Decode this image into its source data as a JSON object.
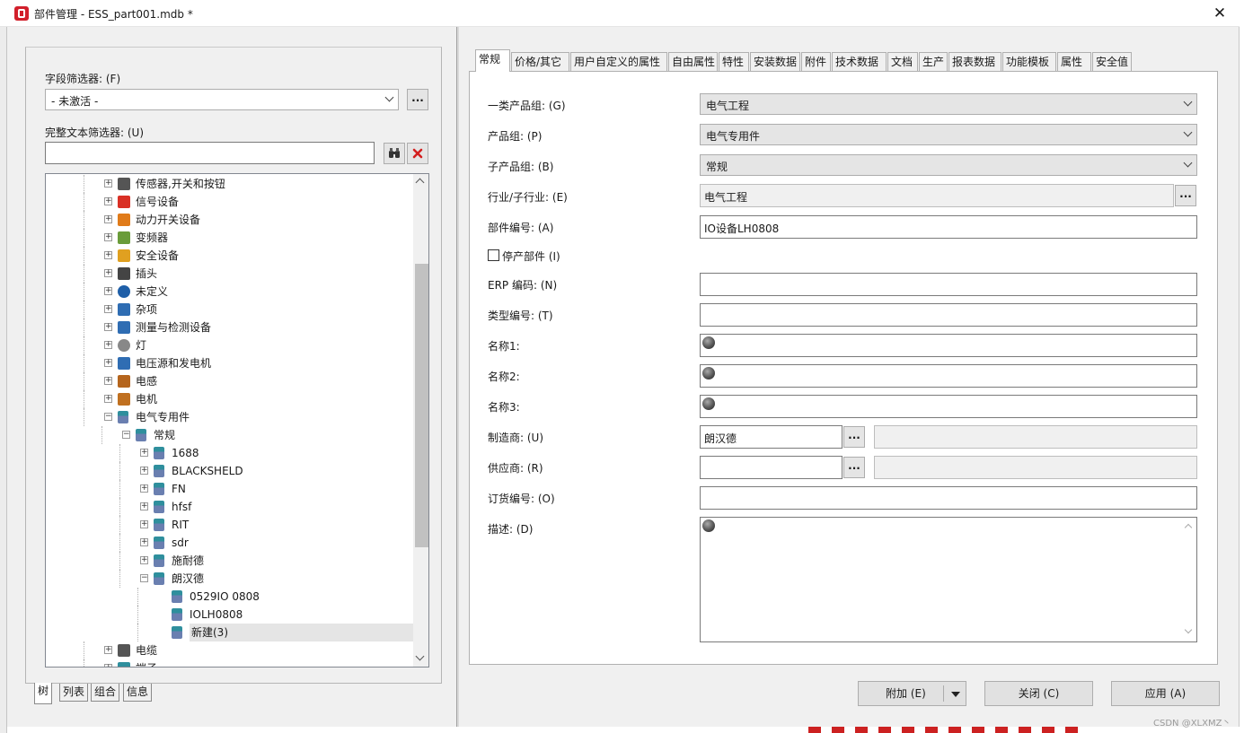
{
  "window": {
    "title": "部件管理 - ESS_part001.mdb *",
    "close": "✕"
  },
  "left": {
    "field_filter_label": "字段筛选器: (F)",
    "field_filter_value": "- 未激活 -",
    "more": "...",
    "text_filter_label": "完整文本筛选器: (U)",
    "text_filter_value": "",
    "tree": [
      {
        "label": "传感器,开关和按钮",
        "level": 0,
        "expander": "+",
        "icon": "sensor-icon",
        "color": "#555555"
      },
      {
        "label": "信号设备",
        "level": 0,
        "expander": "+",
        "icon": "signal-device-icon",
        "color": "#d93025"
      },
      {
        "label": "动力开关设备",
        "level": 0,
        "expander": "+",
        "icon": "power-switch-icon",
        "color": "#e07b1a"
      },
      {
        "label": "变频器",
        "level": 0,
        "expander": "+",
        "icon": "inverter-icon",
        "color": "#6a9c3a"
      },
      {
        "label": "安全设备",
        "level": 0,
        "expander": "+",
        "icon": "safety-device-icon",
        "color": "#e0a020"
      },
      {
        "label": "插头",
        "level": 0,
        "expander": "+",
        "icon": "plug-icon",
        "color": "#444444"
      },
      {
        "label": "未定义",
        "level": 0,
        "expander": "+",
        "icon": "question-icon",
        "color": "#1f5fa8"
      },
      {
        "label": "杂项",
        "level": 0,
        "expander": "+",
        "icon": "misc-icon",
        "color": "#2f6db3"
      },
      {
        "label": "测量与检测设备",
        "level": 0,
        "expander": "+",
        "icon": "meter-icon",
        "color": "#2f6db3"
      },
      {
        "label": "灯",
        "level": 0,
        "expander": "+",
        "icon": "bulb-icon",
        "color": "#888888"
      },
      {
        "label": "电压源和发电机",
        "level": 0,
        "expander": "+",
        "icon": "generator-icon",
        "color": "#2f6db3"
      },
      {
        "label": "电感",
        "level": 0,
        "expander": "+",
        "icon": "inductor-icon",
        "color": "#b5651d"
      },
      {
        "label": "电机",
        "level": 0,
        "expander": "+",
        "icon": "motor-icon",
        "color": "#c07020"
      },
      {
        "label": "电气专用件",
        "level": 0,
        "expander": "−",
        "icon": "component-icon",
        "color": "#2f8f9d"
      },
      {
        "label": "常规",
        "level": 1,
        "expander": "−",
        "icon": "component-icon",
        "color": "#2f8f9d"
      },
      {
        "label": "1688",
        "level": 2,
        "expander": "+",
        "icon": "component-icon",
        "color": "#2f8f9d"
      },
      {
        "label": "BLACKSHELD",
        "level": 2,
        "expander": "+",
        "icon": "component-icon",
        "color": "#2f8f9d"
      },
      {
        "label": "FN",
        "level": 2,
        "expander": "+",
        "icon": "component-icon",
        "color": "#2f8f9d"
      },
      {
        "label": "hfsf",
        "level": 2,
        "expander": "+",
        "icon": "component-icon",
        "color": "#2f8f9d"
      },
      {
        "label": "RIT",
        "level": 2,
        "expander": "+",
        "icon": "component-icon",
        "color": "#2f8f9d"
      },
      {
        "label": "sdr",
        "level": 2,
        "expander": "+",
        "icon": "component-icon",
        "color": "#2f8f9d"
      },
      {
        "label": "施耐德",
        "level": 2,
        "expander": "+",
        "icon": "component-icon",
        "color": "#2f8f9d"
      },
      {
        "label": "朗汉德",
        "level": 2,
        "expander": "−",
        "icon": "component-icon",
        "color": "#2f8f9d"
      },
      {
        "label": "0529IO 0808",
        "level": 3,
        "expander": "",
        "icon": "component-icon",
        "color": "#2f8f9d"
      },
      {
        "label": "IOLH0808",
        "level": 3,
        "expander": "",
        "icon": "component-icon",
        "color": "#2f8f9d"
      },
      {
        "label": "新建(3)",
        "level": 3,
        "expander": "",
        "icon": "component-icon",
        "color": "#2f8f9d",
        "selected": true
      },
      {
        "label": "电缆",
        "level": 0,
        "expander": "+",
        "icon": "cable-icon",
        "color": "#555555"
      },
      {
        "label": "端子",
        "level": 0,
        "expander": "+",
        "icon": "terminal-icon",
        "color": "#2f8f9d"
      }
    ],
    "bottom_tabs": [
      "树",
      "列表",
      "组合",
      "信息"
    ]
  },
  "tabs": [
    "常规",
    "价格/其它",
    "用户自定义的属性",
    "自由属性",
    "特性",
    "安装数据",
    "附件",
    "技术数据",
    "文档",
    "生产",
    "报表数据",
    "功能模板",
    "属性",
    "安全值"
  ],
  "form": {
    "product_group1_label": "一类产品组: (G)",
    "product_group1_value": "电气工程",
    "product_group_label": "产品组: (P)",
    "product_group_value": "电气专用件",
    "subgroup_label": "子产品组: (B)",
    "subgroup_value": "常规",
    "industry_label": "行业/子行业: (E)",
    "industry_value": "电气工程",
    "part_number_label": "部件编号: (A)",
    "part_number_value": "IO设备LH0808",
    "discontinued_label": "停产部件 (I)",
    "erp_label": "ERP 编码: (N)",
    "erp_value": "",
    "type_number_label": "类型编号: (T)",
    "type_number_value": "",
    "name1_label": "名称1:",
    "name2_label": "名称2:",
    "name3_label": "名称3:",
    "manufacturer_label": "制造商: (U)",
    "manufacturer_value": "朗汉德",
    "supplier_label": "供应商: (R)",
    "supplier_value": "",
    "order_number_label": "订货编号: (O)",
    "order_number_value": "",
    "description_label": "描述: (D)",
    "description_value": "",
    "more": "..."
  },
  "buttons": {
    "add": "附加 (E)",
    "close": "关闭 (C)",
    "apply": "应用 (A)"
  },
  "watermark": "CSDN @XLXMZ丶"
}
